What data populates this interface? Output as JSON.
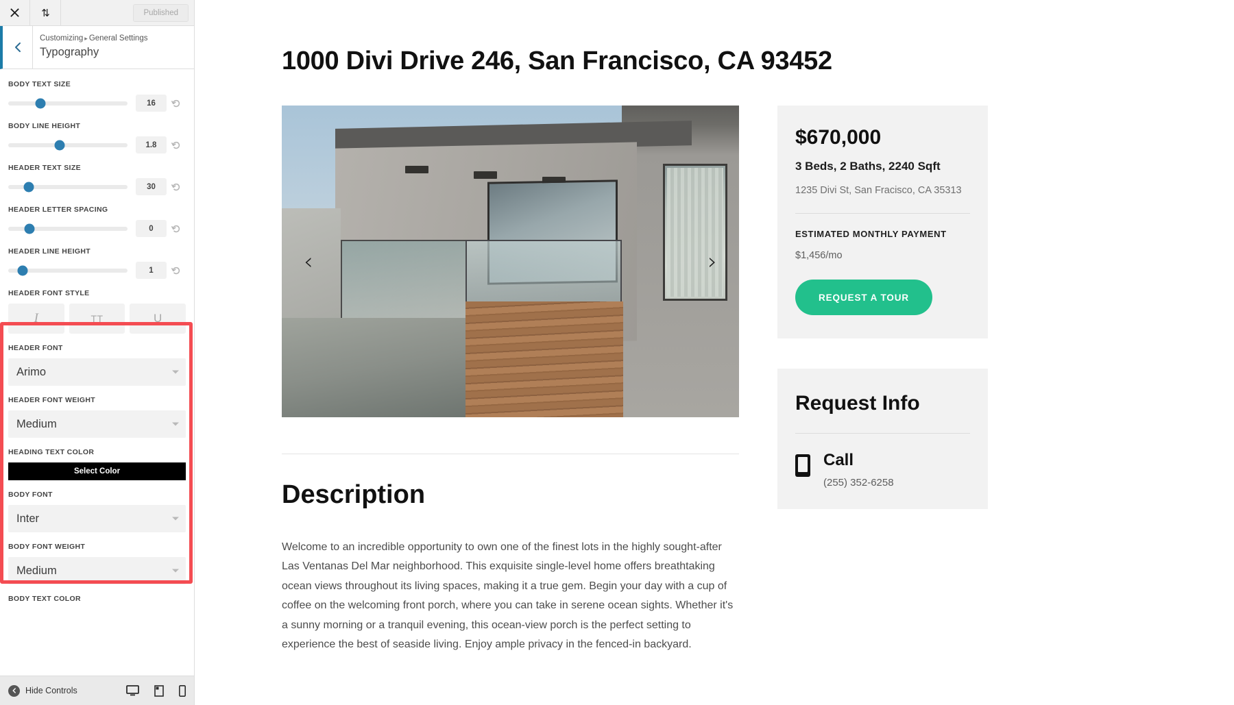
{
  "customizer": {
    "topbar": {
      "close_icon": "close-icon",
      "devices_icon": "sort-arrows-icon",
      "published_label": "Published"
    },
    "header": {
      "back_icon": "chevron-left-icon",
      "breadcrumb_root": "Customizing",
      "breadcrumb_sep": "▸",
      "breadcrumb_parent": "General Settings",
      "section_title": "Typography"
    },
    "sliders": [
      {
        "label": "BODY TEXT SIZE",
        "value": "16",
        "pct": 27
      },
      {
        "label": "BODY LINE HEIGHT",
        "value": "1.8",
        "pct": 43
      },
      {
        "label": "HEADER TEXT SIZE",
        "value": "30",
        "pct": 17
      },
      {
        "label": "HEADER LETTER SPACING",
        "value": "0",
        "pct": 18
      },
      {
        "label": "HEADER LINE HEIGHT",
        "value": "1",
        "pct": 12
      }
    ],
    "font_style": {
      "label": "HEADER FONT STYLE",
      "buttons": [
        {
          "name": "italic-button",
          "glyph": "I"
        },
        {
          "name": "uppercase-button",
          "glyph": "TT"
        },
        {
          "name": "underline-button",
          "glyph": "U"
        }
      ]
    },
    "highlighted_group": {
      "accent_color": "#f44c52",
      "header_font": {
        "label": "HEADER FONT",
        "value": "Arimo"
      },
      "header_font_weight": {
        "label": "HEADER FONT WEIGHT",
        "value": "Medium"
      },
      "heading_text_color": {
        "label": "HEADING TEXT COLOR",
        "button_label": "Select Color",
        "swatch": "#000000"
      },
      "body_font": {
        "label": "BODY FONT",
        "value": "Inter"
      },
      "body_font_weight": {
        "label": "BODY FONT WEIGHT",
        "value": "Medium"
      }
    },
    "body_text_color": {
      "label": "BODY TEXT COLOR"
    },
    "footer": {
      "hide_controls_label": "Hide Controls",
      "icons": [
        "desktop-icon",
        "tablet-icon",
        "mobile-icon"
      ]
    }
  },
  "preview": {
    "page_title": "1000 Divi Drive 246, San Francisco, CA 93452",
    "gallery": {
      "prev_glyph": "‹",
      "next_glyph": "›"
    },
    "description": {
      "heading": "Description",
      "paragraph": "Welcome to an incredible opportunity to own one of the finest lots in the highly sought-after Las Ventanas Del Mar neighborhood. This exquisite single-level home offers breathtaking ocean views throughout its living spaces, making it a true gem. Begin your day with a cup of coffee on the welcoming front porch, where you can take in serene ocean sights. Whether it's a sunny morning or a tranquil evening, this ocean-view porch is the perfect setting to experience the best of seaside living. Enjoy ample privacy in the fenced-in backyard."
    },
    "listing_card": {
      "price": "$670,000",
      "specs": "3 Beds, 2 Baths, 2240 Sqft",
      "address": "1235 Divi St, San Fracisco, CA 35313",
      "payment_label": "ESTIMATED MONTHLY PAYMENT",
      "payment_value": "$1,456/mo",
      "cta_label": "REQUEST A TOUR",
      "cta_color": "#22c08c"
    },
    "request_info": {
      "heading": "Request Info",
      "contact_icon": "phone-icon",
      "contact_label": "Call",
      "contact_number": "(255) 352-6258"
    }
  }
}
